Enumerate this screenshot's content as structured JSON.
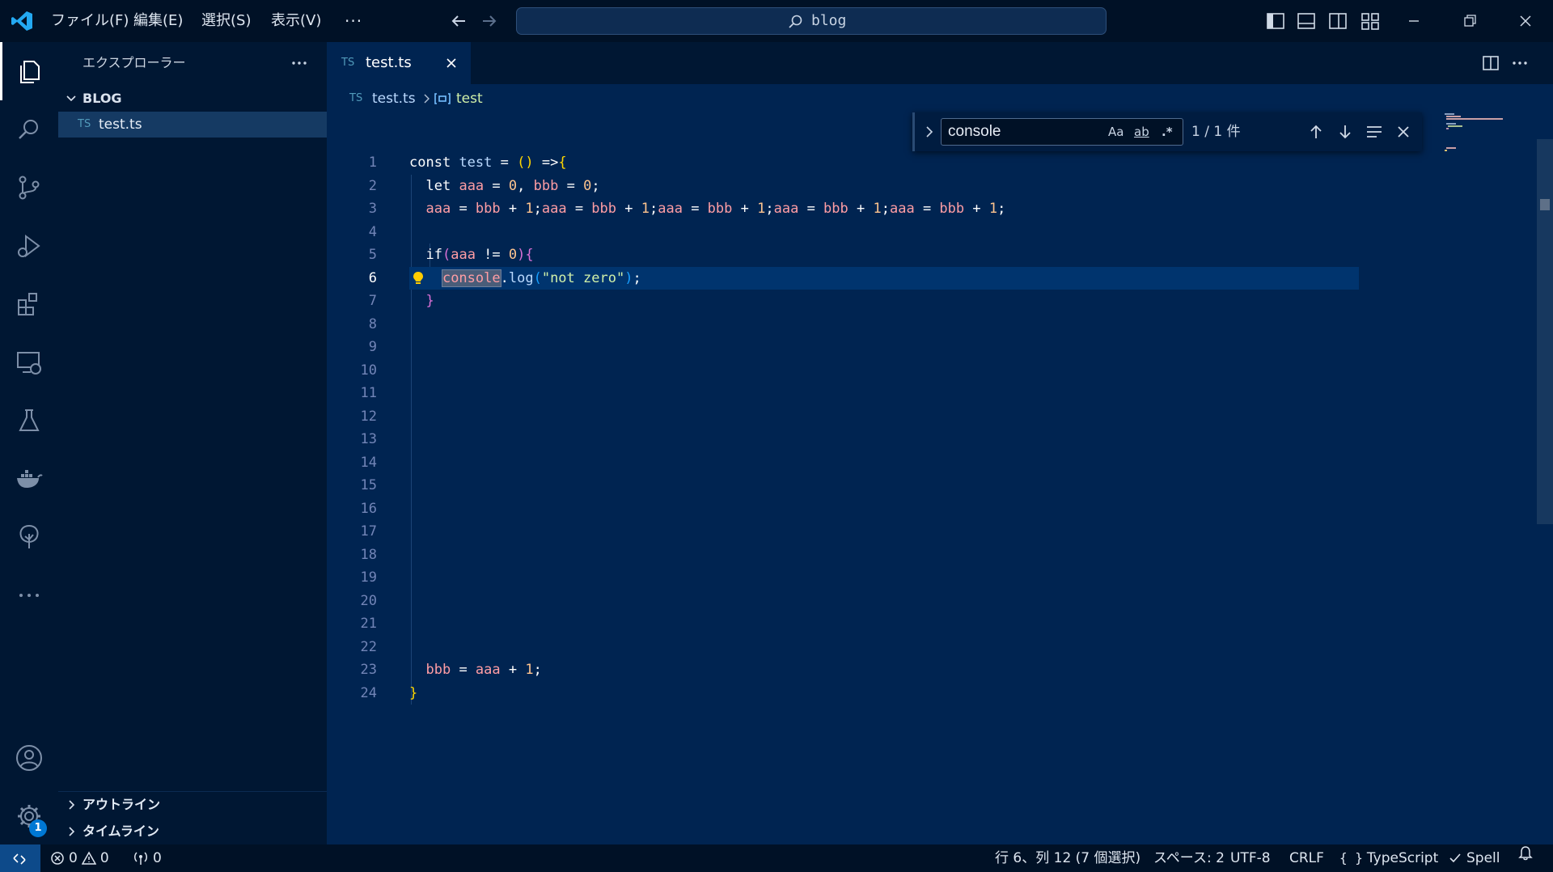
{
  "colors": {
    "editor_bg": "#002451",
    "sidebar_bg": "#001733",
    "titlebar_bg": "#001126",
    "accent": "#0078d4",
    "ts_icon": "#519aba"
  },
  "titlebar": {
    "menus": [
      "ファイル(F)",
      "編集(E)",
      "選択(S)",
      "表示(V)"
    ],
    "more_label": "···",
    "search_text": "blog"
  },
  "activity_bar": {
    "items": [
      "explorer-icon",
      "search-icon",
      "source-control-icon",
      "run-debug-icon",
      "extensions-icon",
      "remote-explorer-icon",
      "testing-icon",
      "docker-icon",
      "tree-icon",
      "more-icon"
    ],
    "account_icon": "account-icon",
    "settings_badge": "1"
  },
  "sidebar": {
    "title": "エクスプローラー",
    "folder": "BLOG",
    "files": [
      {
        "lang": "TS",
        "name": "test.ts"
      }
    ],
    "outline": "アウトライン",
    "timeline": "タイムライン"
  },
  "editor": {
    "tab": {
      "lang": "TS",
      "name": "test.ts"
    },
    "breadcrumb": {
      "lang": "TS",
      "file": "test.ts",
      "symbol": "test"
    }
  },
  "find": {
    "query": "console",
    "case_label": "Aa",
    "word_label": "ab",
    "regex_label": ".*",
    "count": "1 / 1 件"
  },
  "code": {
    "line_numbers": [
      "1",
      "2",
      "3",
      "4",
      "5",
      "6",
      "7",
      "8",
      "9",
      "10",
      "11",
      "12",
      "13",
      "14",
      "15",
      "16",
      "17",
      "18",
      "19",
      "20",
      "21",
      "22",
      "23",
      "24"
    ],
    "current_line": 6
  },
  "statusbar": {
    "errors": "0",
    "warnings": "0",
    "ports": "0",
    "cursor": "行 6、列 12 (7 個選択)",
    "spaces": "スペース: 2",
    "encoding": "UTF-8",
    "eol": "CRLF",
    "language": "TypeScript",
    "spell": "Spell"
  }
}
